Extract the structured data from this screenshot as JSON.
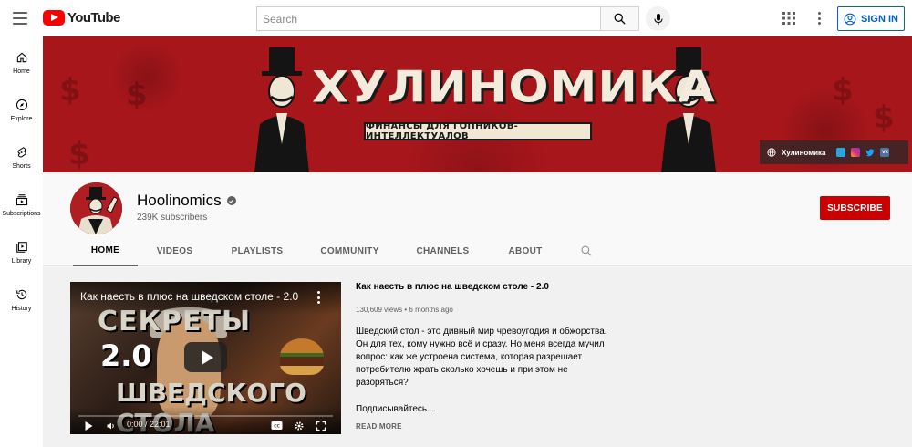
{
  "header": {
    "logo_text": "YouTube",
    "search_placeholder": "Search",
    "signin_label": "SIGN IN"
  },
  "sidebar": {
    "items": [
      {
        "label": "Home",
        "icon": "home-icon"
      },
      {
        "label": "Explore",
        "icon": "compass-icon"
      },
      {
        "label": "Shorts",
        "icon": "shorts-icon"
      },
      {
        "label": "Subscriptions",
        "icon": "subscriptions-icon"
      },
      {
        "label": "Library",
        "icon": "library-icon"
      },
      {
        "label": "History",
        "icon": "history-icon"
      }
    ]
  },
  "banner": {
    "title": "ХУЛИНОМИКА",
    "subtitle": "ФИНАНСЫ ДЛЯ ГОПНИКОВ-ИНТЕЛЛЕКТУАЛОВ",
    "link_label": "Хулиномика",
    "social_icons": [
      "telegram-icon",
      "instagram-icon",
      "twitter-icon",
      "vk-icon"
    ]
  },
  "channel": {
    "name": "Hoolinomics",
    "subscribers": "239K subscribers",
    "subscribe_label": "SUBSCRIBE",
    "tabs": [
      "HOME",
      "VIDEOS",
      "PLAYLISTS",
      "COMMUNITY",
      "CHANNELS",
      "ABOUT"
    ],
    "active_tab": "HOME"
  },
  "featured_video": {
    "player_title": "Как наесть в плюс на шведском столе - 2.0",
    "thumb_text_top": "СЕКРЕТЫ",
    "thumb_text_mid": "2.0",
    "thumb_text_bottom": "ШВЕДСКОГО СТОЛА",
    "time": "0:00 / 22:01",
    "title": "Как наесть в плюс на шведском столе - 2.0",
    "meta": "130,609 views • 6 months ago",
    "description": "Шведский стол - это дивный мир чревоугодия и обжорства. Он для тех, кому нужно всё и сразу. Но меня всегда мучил вопрос: как же устроена система, которая разрешает потребителю жрать сколько хочешь и при этом не разоряться?",
    "description_2": "Подписывайтесь…",
    "read_more": "READ MORE"
  },
  "colors": {
    "brand_red": "#ff0000",
    "subscribe_red": "#cc0000",
    "banner_red": "#a7161b",
    "link_blue": "#065fd4"
  }
}
